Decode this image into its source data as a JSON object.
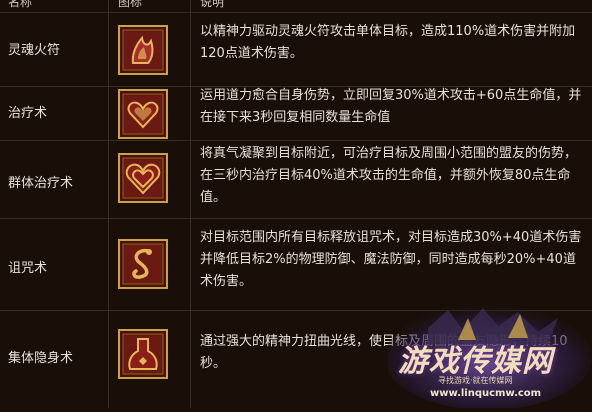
{
  "header": {
    "col_name": "名称",
    "col_icon": "图标",
    "col_desc": "说明"
  },
  "skills": [
    {
      "name": "灵魂火符",
      "icon": "fire-talisman-icon",
      "desc": "以精神力驱动灵魂火符攻击单体目标，造成110%道术伤害并附加120点道术伤害。"
    },
    {
      "name": "治疗术",
      "icon": "heal-heart-icon",
      "desc": "运用道力愈合自身伤势，立即回复30%道术攻击+60点生命值，并在接下来3秒回复相同数量生命值"
    },
    {
      "name": "群体治疗术",
      "icon": "group-heal-heart-icon",
      "desc": "将真气凝聚到目标附近，可治疗目标及周围小范围的盟友的伤势，在三秒内治疗目标40%道术攻击的生命值，并额外恢复80点生命值。"
    },
    {
      "name": "诅咒术",
      "icon": "curse-serpent-icon",
      "desc": "对目标范围内所有目标释放诅咒术，对目标造成30%+40道术伤害并降低目标2%的物理防御、魔法防御，同时造成每秒20%+40道术伤害。"
    },
    {
      "name": "集体隐身术",
      "icon": "group-stealth-icon",
      "desc": "通过强大的精神力扭曲光线，使目标及周围的盟友隐形，持续10秒。"
    }
  ],
  "watermark": {
    "title": "游戏传媒网",
    "subtitle": "寻找游戏·就在传媒网",
    "url": "www.linqucmw.com"
  },
  "colors": {
    "bg": "#1a0f08",
    "grid": "#3a2c22",
    "icon_border": "#c9a24a",
    "icon_bg": "#5a1410",
    "text": "#e6e0d8"
  }
}
